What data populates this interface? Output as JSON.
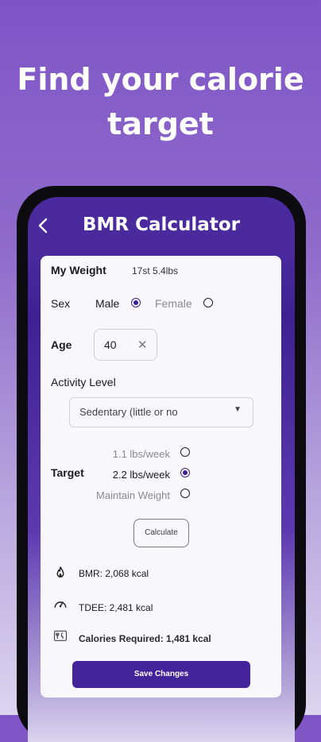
{
  "headline": {
    "line1": "Find your calorie",
    "line2": "target"
  },
  "app": {
    "title": "BMR Calculator",
    "back_icon": "chevron-left-icon"
  },
  "weight": {
    "label": "My Weight",
    "value": "17st 5.4lbs"
  },
  "sex": {
    "label": "Sex",
    "options": [
      {
        "label": "Male",
        "selected": true
      },
      {
        "label": "Female",
        "selected": false
      }
    ]
  },
  "age": {
    "label": "Age",
    "value": "40",
    "clear_icon": "close-icon"
  },
  "activity": {
    "label": "Activity Level",
    "selected": "Sedentary (little or no",
    "arrow_icon": "chevron-down-icon"
  },
  "target": {
    "label": "Target",
    "options": [
      {
        "label": "1.1 lbs/week",
        "selected": false
      },
      {
        "label": "2.2 lbs/week",
        "selected": true
      },
      {
        "label": "Maintain Weight",
        "selected": false
      }
    ]
  },
  "calculate_label": "Calculate",
  "results": [
    {
      "icon": "flame-icon",
      "text": "BMR: 2,068 kcal"
    },
    {
      "icon": "speedometer-icon",
      "text": "TDEE: 2,481 kcal"
    },
    {
      "icon": "cutlery-icon",
      "text": "Calories Required: 1,481 kcal"
    }
  ],
  "save_label": "Save Changes",
  "colors": {
    "primary": "#44249a",
    "background_top": "#7f55c6",
    "card": "#f8f7fb"
  }
}
